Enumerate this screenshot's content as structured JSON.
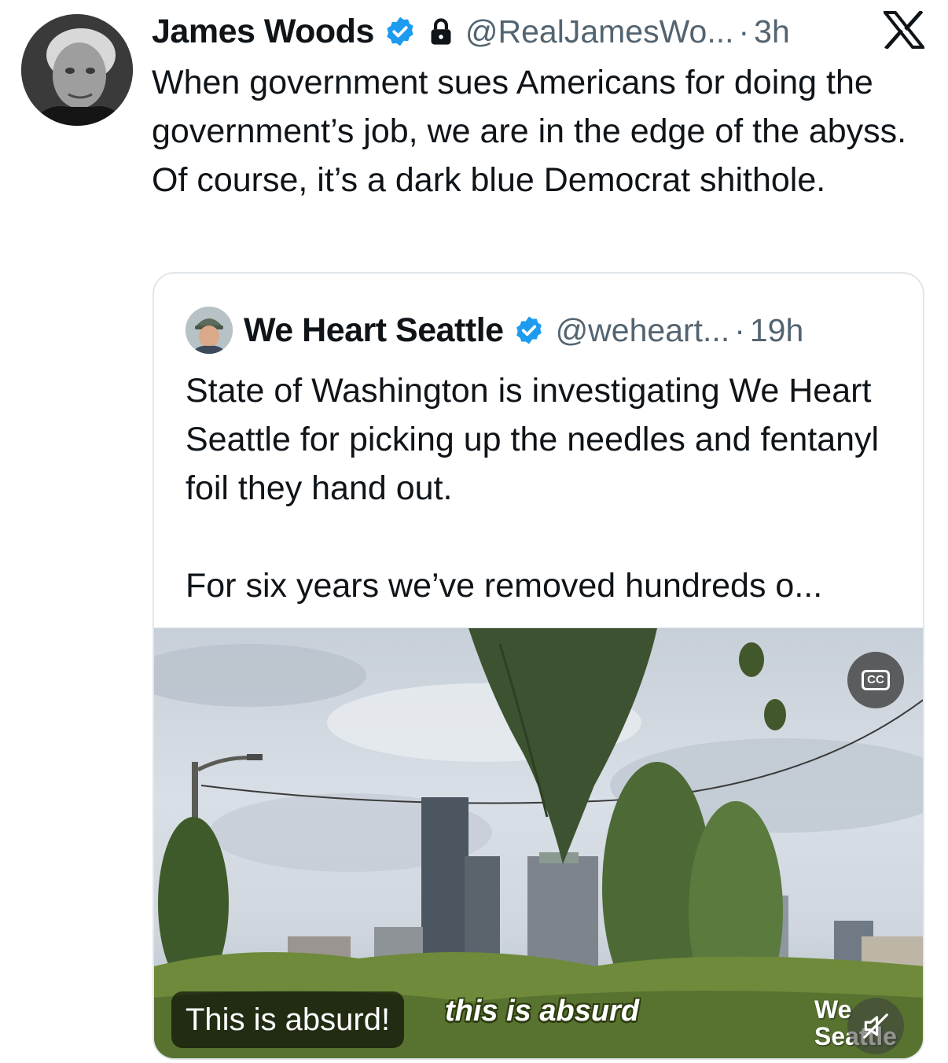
{
  "tweet": {
    "author_name": "James Woods",
    "handle": "@RealJamesWo...",
    "separator": "·",
    "time": "3h",
    "text": "When government sues Americans for doing the government’s job, we are in the edge of the abyss. Of course, it’s a dark blue Democrat shithole."
  },
  "quote": {
    "author_name": "We Heart Seattle",
    "handle": "@weheart...",
    "separator": "·",
    "time": "19h",
    "paragraph_1": "State of Washington is investigating We Heart Seattle for picking up the needles and fentanyl foil they hand out.",
    "paragraph_2": "For six years we’ve removed hundreds o...",
    "video": {
      "caption": "This is absurd!",
      "burned_subtitle": "this is absurd",
      "watermark": "We\nSeattle",
      "cc_label": "CC"
    }
  },
  "icons": {
    "verified": "verified-badge-icon",
    "lock": "lock-icon",
    "brand": "x-logo-icon",
    "captions": "closed-captions-icon",
    "mute": "muted-speaker-icon"
  },
  "colors": {
    "verified_blue": "#1d9bf0",
    "text": "#0f1419",
    "secondary_text": "#536471",
    "border": "#e1e6ea"
  }
}
